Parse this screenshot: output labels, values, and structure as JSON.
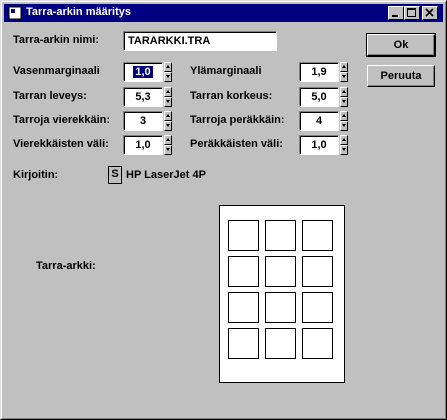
{
  "window": {
    "title": "Tarra-arkin määritys"
  },
  "name_label": "Tarra-arkin nimi:",
  "name_value": "TARARKKI.TRA",
  "fields": {
    "left_margin": {
      "label": "Vasenmarginaali",
      "value": "1,0"
    },
    "top_margin": {
      "label": "Ylämarginaali",
      "value": "1,9"
    },
    "label_width": {
      "label": "Tarran leveys:",
      "value": "5,3"
    },
    "label_height": {
      "label": "Tarran korkeus:",
      "value": "5,0"
    },
    "labels_across": {
      "label": "Tarroja vierekkäin:",
      "value": "3"
    },
    "labels_down": {
      "label": "Tarroja peräkkäin:",
      "value": "4"
    },
    "horizontal_gap": {
      "label": "Vierekkäisten väli:",
      "value": "1,0"
    },
    "vertical_gap": {
      "label": "Peräkkäisten väli:",
      "value": "1,0"
    }
  },
  "printer": {
    "label": "Kirjoitin:",
    "button": "S",
    "name": "HP LaserJet 4P"
  },
  "sheet_label": "Tarra-arkki:",
  "buttons": {
    "ok": "Ok",
    "cancel": "Peruuta"
  },
  "colors": {
    "titlebar": "#000080",
    "face": "#c0c0c0"
  }
}
